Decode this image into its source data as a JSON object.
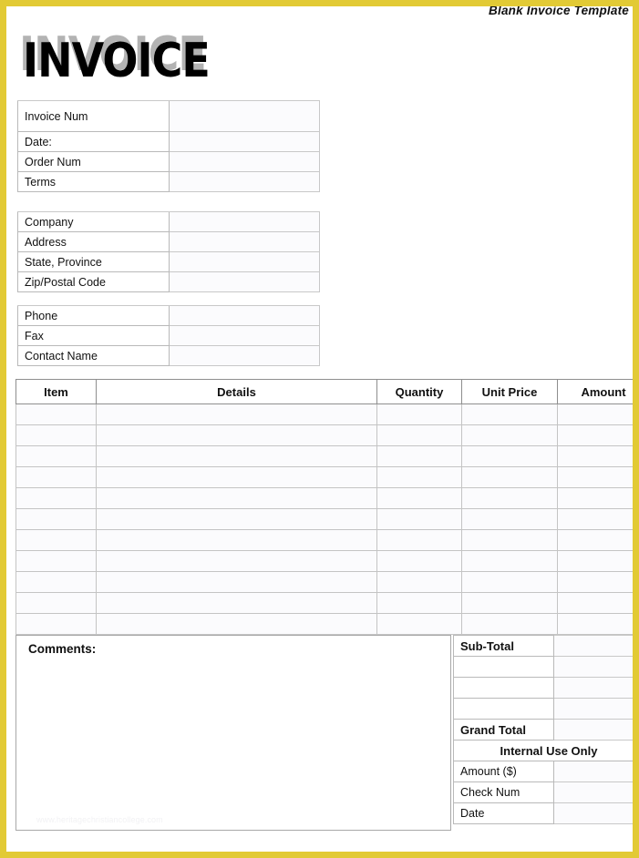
{
  "header": {
    "doc_title": "Blank Invoice Template"
  },
  "wordmark": {
    "text": "INVOICE"
  },
  "invoice_block": {
    "rows": [
      {
        "label": "Invoice Num",
        "value": ""
      },
      {
        "label": "Date:",
        "value": ""
      },
      {
        "label": "Order Num",
        "value": ""
      },
      {
        "label": "Terms",
        "value": ""
      }
    ]
  },
  "company_block": {
    "rows": [
      {
        "label": "Company",
        "value": ""
      },
      {
        "label": "Address",
        "value": ""
      },
      {
        "label": "State, Province",
        "value": ""
      },
      {
        "label": "Zip/Postal Code",
        "value": ""
      }
    ]
  },
  "contact_block": {
    "rows": [
      {
        "label": "Phone",
        "value": ""
      },
      {
        "label": "Fax",
        "value": ""
      },
      {
        "label": "Contact Name",
        "value": ""
      }
    ]
  },
  "items_table": {
    "columns": [
      "Item",
      "Details",
      "Quantity",
      "Unit Price",
      "Amount"
    ],
    "row_count": 11,
    "rows": [
      {
        "item": "",
        "details": "",
        "quantity": "",
        "unit_price": "",
        "amount": ""
      },
      {
        "item": "",
        "details": "",
        "quantity": "",
        "unit_price": "",
        "amount": ""
      },
      {
        "item": "",
        "details": "",
        "quantity": "",
        "unit_price": "",
        "amount": ""
      },
      {
        "item": "",
        "details": "",
        "quantity": "",
        "unit_price": "",
        "amount": ""
      },
      {
        "item": "",
        "details": "",
        "quantity": "",
        "unit_price": "",
        "amount": ""
      },
      {
        "item": "",
        "details": "",
        "quantity": "",
        "unit_price": "",
        "amount": ""
      },
      {
        "item": "",
        "details": "",
        "quantity": "",
        "unit_price": "",
        "amount": ""
      },
      {
        "item": "",
        "details": "",
        "quantity": "",
        "unit_price": "",
        "amount": ""
      },
      {
        "item": "",
        "details": "",
        "quantity": "",
        "unit_price": "",
        "amount": ""
      },
      {
        "item": "",
        "details": "",
        "quantity": "",
        "unit_price": "",
        "amount": ""
      },
      {
        "item": "",
        "details": "",
        "quantity": "",
        "unit_price": "",
        "amount": ""
      }
    ]
  },
  "comments": {
    "label": "Comments:",
    "value": "",
    "watermark": "www.heritagechristiancollege.com"
  },
  "totals": {
    "sub_total_label": "Sub-Total",
    "sub_total_value": "",
    "blank_rows": [
      {
        "label": "",
        "value": ""
      },
      {
        "label": "",
        "value": ""
      },
      {
        "label": "",
        "value": ""
      }
    ],
    "grand_total_label": "Grand Total",
    "grand_total_value": "",
    "internal_header": "Internal Use Only",
    "internal_rows": [
      {
        "label": "Amount ($)",
        "value": ""
      },
      {
        "label": "Check Num",
        "value": ""
      },
      {
        "label": "Date",
        "value": ""
      }
    ]
  },
  "colors": {
    "border_accent": "#e2ca35",
    "field_fill": "#fbfbfd",
    "grid_line": "#b9b9b9",
    "text": "#111111",
    "wordmark_shadow": "#b3b3b3"
  }
}
